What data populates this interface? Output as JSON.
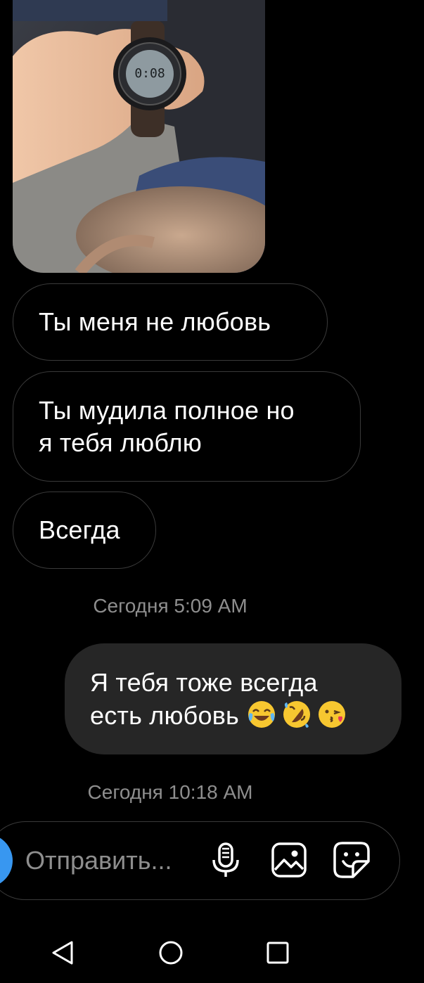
{
  "thread": {
    "messages": [
      {
        "direction": "incoming",
        "text": "Ты меня не любовь"
      },
      {
        "direction": "incoming",
        "text": "Ты мудила полное но\nя тебя люблю"
      },
      {
        "direction": "incoming",
        "text": "Всегда"
      },
      {
        "direction": "outgoing",
        "text": "Я тебя тоже всегда\nесть любовь",
        "emojis": [
          "face-with-tears-of-joy",
          "rolling-on-the-floor-laughing",
          "face-blowing-a-kiss"
        ]
      }
    ],
    "timestamps": [
      "Сегодня 5:09 AM",
      "Сегодня 10:18 AM"
    ],
    "photo": {
      "watch_display": "0:08"
    }
  },
  "composer": {
    "placeholder": "Отправить...",
    "camera_color": "#3897f0",
    "icons": [
      "camera-icon",
      "microphone-icon",
      "gallery-icon",
      "sticker-icon"
    ]
  },
  "navbar": {
    "icons": [
      "back-icon",
      "home-icon",
      "recents-icon"
    ]
  },
  "colors": {
    "background": "#000000",
    "outgoing_bubble": "#262626",
    "incoming_border": "#3a3a3a",
    "timestamp": "#8e8e8e",
    "accent": "#3897f0"
  }
}
